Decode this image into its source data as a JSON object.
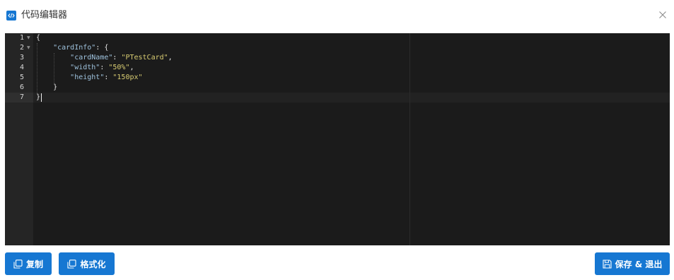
{
  "dialog": {
    "title": "代码编辑器",
    "title_icon": "code-window-icon",
    "close_icon": "close-icon"
  },
  "editor": {
    "theme_background": "#1b1b1b",
    "line_numbers": [
      "1",
      "2",
      "3",
      "4",
      "5",
      "6",
      "7"
    ],
    "lines": [
      {
        "tokens": [
          {
            "t": "{",
            "c": "p"
          }
        ]
      },
      {
        "tokens": [
          {
            "t": "    ",
            "c": "p"
          },
          {
            "t": "\"cardInfo\"",
            "c": "k"
          },
          {
            "t": ": {",
            "c": "p"
          }
        ]
      },
      {
        "tokens": [
          {
            "t": "        ",
            "c": "p"
          },
          {
            "t": "\"cardName\"",
            "c": "k"
          },
          {
            "t": ": ",
            "c": "p"
          },
          {
            "t": "\"PTestCard\"",
            "c": "s"
          },
          {
            "t": ",",
            "c": "p"
          }
        ]
      },
      {
        "tokens": [
          {
            "t": "        ",
            "c": "p"
          },
          {
            "t": "\"width\"",
            "c": "k"
          },
          {
            "t": ": ",
            "c": "p"
          },
          {
            "t": "\"50%\"",
            "c": "s"
          },
          {
            "t": ",",
            "c": "p"
          }
        ]
      },
      {
        "tokens": [
          {
            "t": "        ",
            "c": "p"
          },
          {
            "t": "\"height\"",
            "c": "k"
          },
          {
            "t": ": ",
            "c": "p"
          },
          {
            "t": "\"150px\"",
            "c": "s"
          }
        ]
      },
      {
        "tokens": [
          {
            "t": "    }",
            "c": "p"
          }
        ]
      },
      {
        "tokens": [
          {
            "t": "}",
            "c": "p"
          }
        ]
      }
    ],
    "active_line": 7,
    "fold_markers": [
      "1",
      "2"
    ]
  },
  "footer": {
    "copy_label": "复制",
    "copy_icon": "copy-icon",
    "format_label": "格式化",
    "format_icon": "format-icon",
    "save_exit_label": "保存 & 退出",
    "save_icon": "save-icon"
  },
  "colors": {
    "accent": "#1677d2",
    "key": "#9fc3de",
    "string": "#d8cc72"
  }
}
